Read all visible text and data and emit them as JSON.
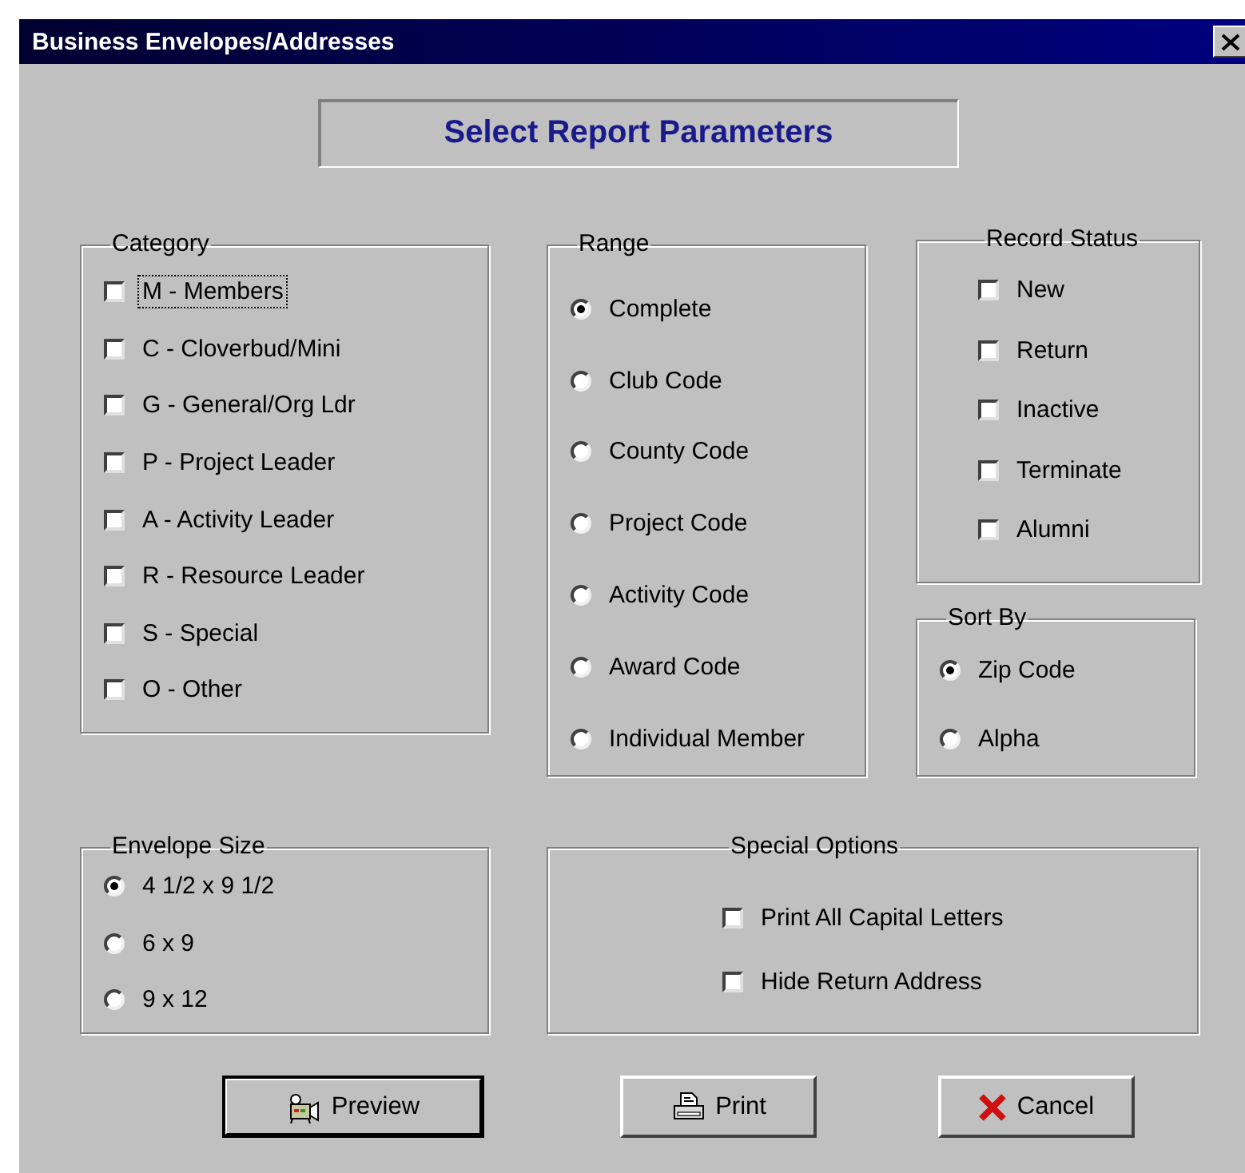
{
  "window": {
    "title": "Business Envelopes/Addresses"
  },
  "header": "Select Report Parameters",
  "category": {
    "title": "Category",
    "items": [
      {
        "label": "M - Members",
        "checked": false,
        "focused": true
      },
      {
        "label": "C - Cloverbud/Mini",
        "checked": false,
        "focused": false
      },
      {
        "label": "G - General/Org Ldr",
        "checked": false,
        "focused": false
      },
      {
        "label": "P - Project Leader",
        "checked": false,
        "focused": false
      },
      {
        "label": "A - Activity Leader",
        "checked": false,
        "focused": false
      },
      {
        "label": "R - Resource Leader",
        "checked": false,
        "focused": false
      },
      {
        "label": "S - Special",
        "checked": false,
        "focused": false
      },
      {
        "label": "O - Other",
        "checked": false,
        "focused": false
      }
    ]
  },
  "range": {
    "title": "Range",
    "options": [
      {
        "label": "Complete",
        "selected": true
      },
      {
        "label": "Club Code",
        "selected": false
      },
      {
        "label": "County Code",
        "selected": false
      },
      {
        "label": "Project Code",
        "selected": false
      },
      {
        "label": "Activity Code",
        "selected": false
      },
      {
        "label": "Award Code",
        "selected": false
      },
      {
        "label": "Individual Member",
        "selected": false
      }
    ]
  },
  "record_status": {
    "title": "Record Status",
    "items": [
      {
        "label": "New",
        "checked": false
      },
      {
        "label": "Return",
        "checked": false
      },
      {
        "label": "Inactive",
        "checked": false
      },
      {
        "label": "Terminate",
        "checked": false
      },
      {
        "label": "Alumni",
        "checked": false
      }
    ]
  },
  "sort_by": {
    "title": "Sort By",
    "options": [
      {
        "label": "Zip Code",
        "selected": true
      },
      {
        "label": "Alpha",
        "selected": false
      }
    ]
  },
  "envelope_size": {
    "title": "Envelope Size",
    "options": [
      {
        "label": "4 1/2 x 9 1/2",
        "selected": true
      },
      {
        "label": "6 x 9",
        "selected": false
      },
      {
        "label": "9 x 12",
        "selected": false
      }
    ]
  },
  "special_options": {
    "title": "Special Options",
    "items": [
      {
        "label": "Print All Capital Letters",
        "checked": false
      },
      {
        "label": "Hide Return Address",
        "checked": false
      }
    ]
  },
  "buttons": [
    {
      "label": "Preview",
      "kind": "preview",
      "default": true
    },
    {
      "label": "Print",
      "kind": "print",
      "default": false
    },
    {
      "label": "Cancel",
      "kind": "cancel",
      "default": false
    }
  ]
}
